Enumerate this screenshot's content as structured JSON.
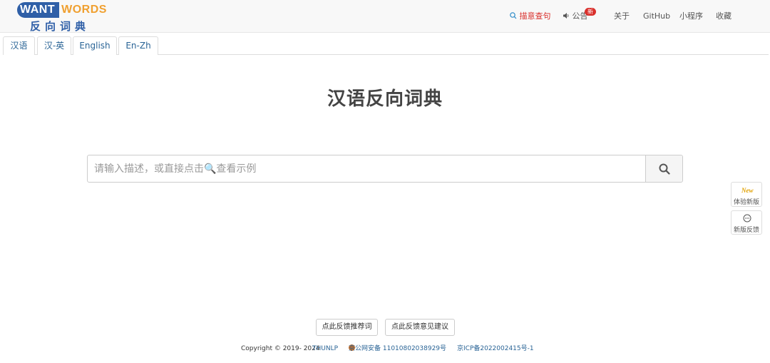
{
  "logo": {
    "want": "WANT",
    "words": "WORDS",
    "subtitle": "反向词典"
  },
  "nav": {
    "quote_search": "描意查句",
    "announcement": "公告",
    "announcement_badge": "新",
    "about": "关于",
    "github": "GitHub",
    "mini_program": "小程序",
    "favorite": "收藏"
  },
  "tabs": [
    {
      "label": "汉语",
      "active": true
    },
    {
      "label": "汉-英",
      "active": false
    },
    {
      "label": "English",
      "active": false
    },
    {
      "label": "En-Zh",
      "active": false
    }
  ],
  "title": "汉语反向词典",
  "search": {
    "placeholder": "请输入描述，或直接点击🔍查看示例",
    "value": ""
  },
  "floating": {
    "try_new_icon": "New",
    "try_new": "体验新版",
    "feedback_new": "新版反馈"
  },
  "footer": {
    "feedback_words": "点此反馈推荐词",
    "feedback_suggestions": "点此反馈意见建议",
    "copyright": "Copyright © 2019- 2024",
    "org": "THUNLP",
    "police_record": "京公网安备 11010802038929号",
    "icp_record": "京ICP备2022002415号-1"
  },
  "colors": {
    "brand_blue": "#2f5fa7",
    "brand_orange": "#f0a030",
    "link": "#2a6496",
    "highlight_red": "#d9302c"
  }
}
